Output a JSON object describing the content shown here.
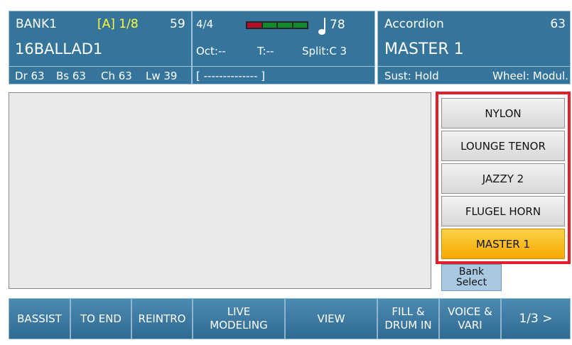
{
  "style_panel": {
    "bank": "BANK1",
    "variation": "[A] 1/8",
    "tempo_style": "59",
    "name": "16BALLAD1",
    "parts": [
      "Dr 63",
      "Bs 63",
      "Ch 63",
      "Lw 39"
    ]
  },
  "middle_panel": {
    "time_signature": "4/4",
    "tempo": "78",
    "octave": "Oct:--",
    "transpose": "T:--",
    "split": "Split:C 3",
    "lyrics_line": "[ -------------- ]",
    "beat_bar": {
      "colors": [
        "#b0102a",
        "#0f8a2e",
        "#0f8a2e",
        "#0f8a2e"
      ],
      "note_icon": "quarter-note-icon"
    }
  },
  "voice_panel": {
    "voice": "Accordion",
    "voice_number": "63",
    "name": "MASTER 1",
    "sustain": "Sust: Hold",
    "wheel": "Wheel: Modul."
  },
  "selection_list": [
    "NYLON",
    "LOUNGE TENOR",
    "JAZZY 2",
    "FLUGEL HORN",
    "MASTER 1"
  ],
  "selected_index": 4,
  "bank_select": [
    "Bank",
    "Select"
  ],
  "function_buttons": [
    [
      "BASSIST"
    ],
    [
      "TO END"
    ],
    [
      "REINTRO"
    ],
    [
      "LIVE",
      "MODELING"
    ],
    [
      "VIEW"
    ],
    [
      "FILL &",
      "DRUM IN"
    ],
    [
      "VOICE &",
      "VARI"
    ],
    [
      "1/3 >"
    ]
  ]
}
